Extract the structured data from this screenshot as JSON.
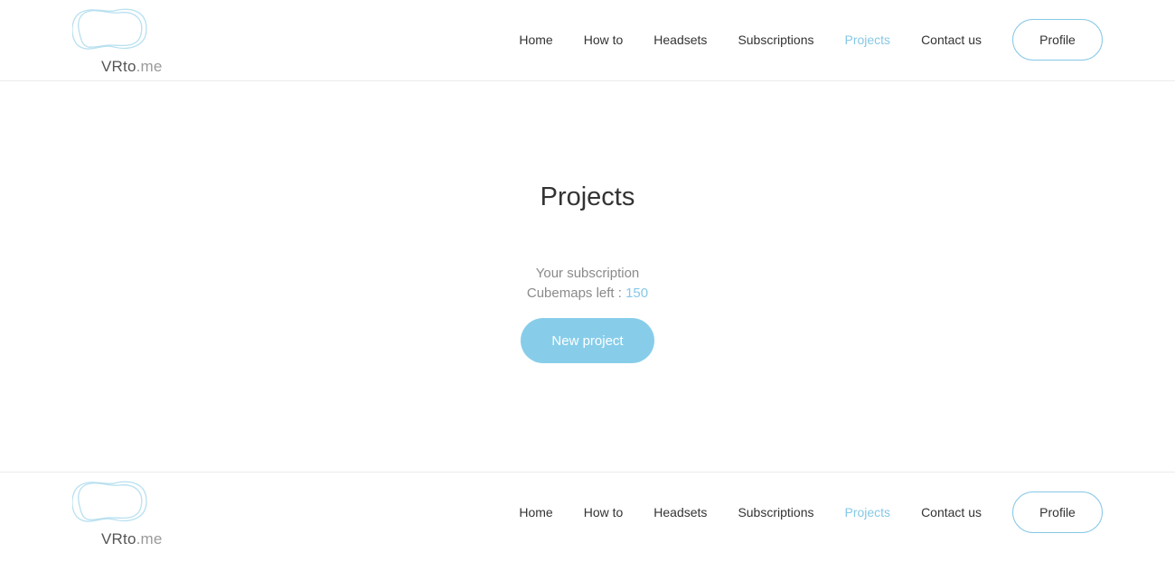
{
  "brand": {
    "name": "VRto",
    "suffix": ".me",
    "accent_color": "#86c8e6"
  },
  "nav": {
    "items": [
      {
        "label": "Home"
      },
      {
        "label": "How to"
      },
      {
        "label": "Headsets"
      },
      {
        "label": "Subscriptions"
      },
      {
        "label": "Projects",
        "active": true
      },
      {
        "label": "Contact us"
      }
    ],
    "profile_label": "Profile"
  },
  "main": {
    "title": "Projects",
    "subscription_label": "Your subscription",
    "cubemaps_label": "Cubemaps left : ",
    "cubemaps_count": "150",
    "new_project_label": "New project",
    "button_color": "#87cdea"
  }
}
